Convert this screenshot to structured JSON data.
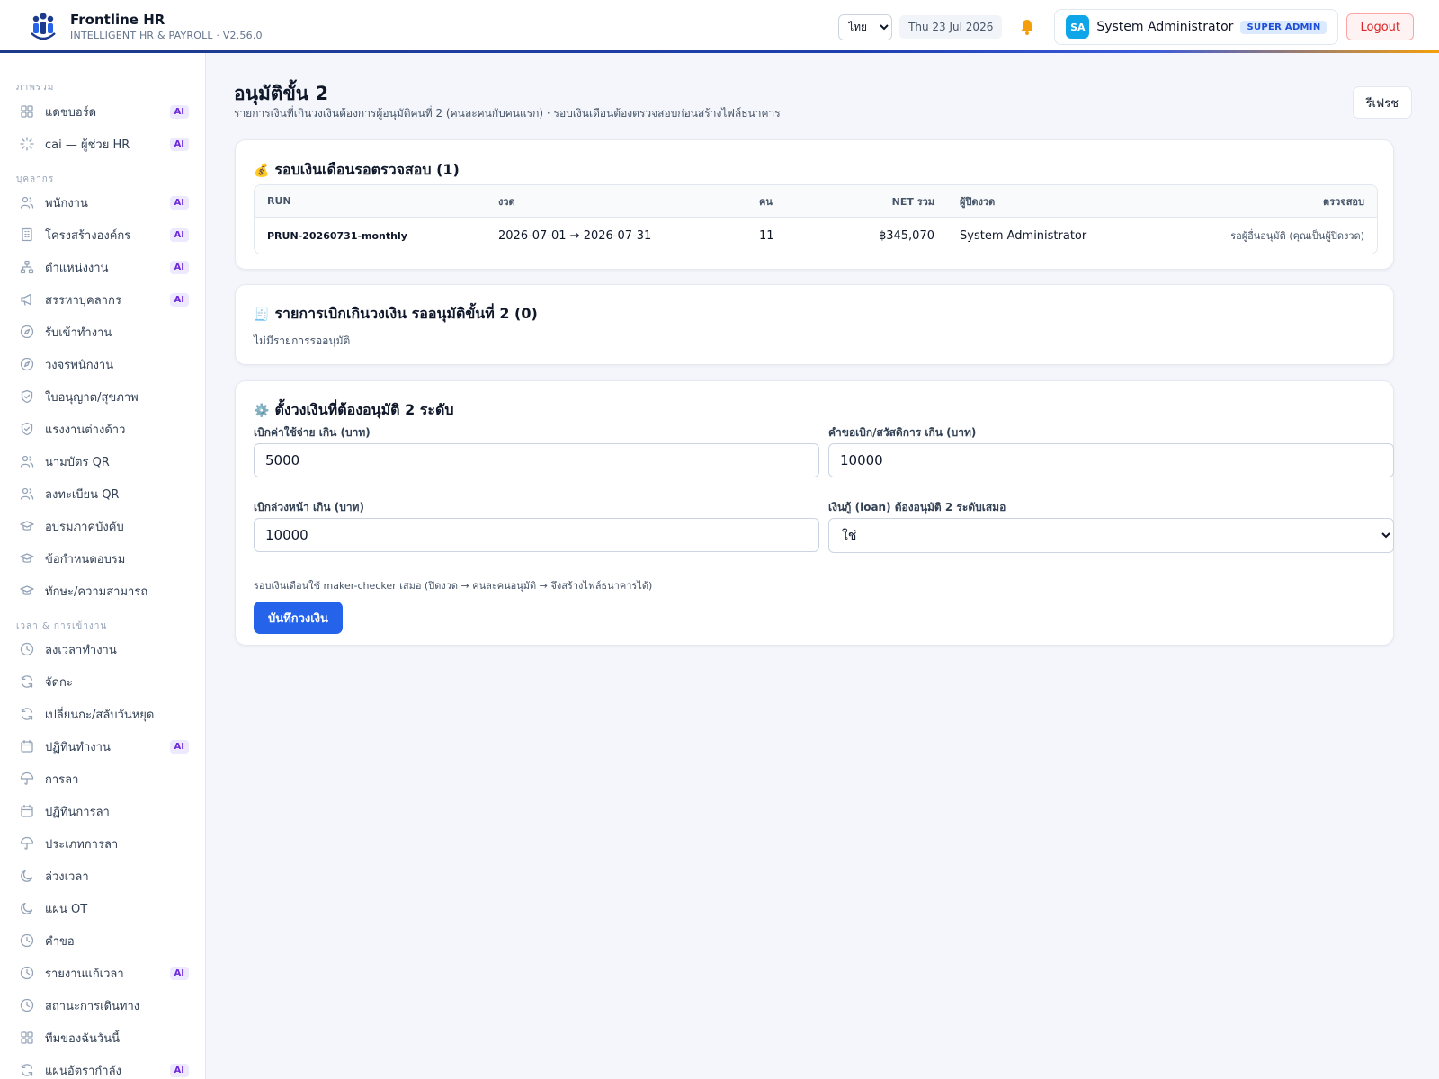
{
  "app": {
    "name": "Frontline HR",
    "subtitle": "INTELLIGENT HR & PAYROLL · V2.56.0"
  },
  "header": {
    "language": "ไทย",
    "date": "Thu 23 Jul 2026",
    "user_initials": "SA",
    "user_name": "System Administrator",
    "role": "SUPER ADMIN",
    "logout_label": "Logout"
  },
  "sidebar": {
    "sections": [
      {
        "title": "ภาพรวม",
        "items": [
          {
            "label": "แดชบอร์ด",
            "icon": "grid-icon",
            "ai": "AI"
          },
          {
            "label": "cai — ผู้ช่วย HR",
            "icon": "sparkle-icon",
            "ai": "AI"
          }
        ]
      },
      {
        "title": "บุคลากร",
        "items": [
          {
            "label": "พนักงาน",
            "icon": "users-icon",
            "ai": "AI"
          },
          {
            "label": "โครงสร้างองค์กร",
            "icon": "building-icon",
            "ai": "AI"
          },
          {
            "label": "ตำแหน่งงาน",
            "icon": "org-chart-icon",
            "ai": "AI"
          },
          {
            "label": "สรรหาบุคลากร",
            "icon": "megaphone-icon",
            "ai": "AI"
          },
          {
            "label": "รับเข้าทำงาน",
            "icon": "compass-icon",
            "ai": ""
          },
          {
            "label": "วงจรพนักงาน",
            "icon": "compass-icon",
            "ai": ""
          },
          {
            "label": "ใบอนุญาต/สุขภาพ",
            "icon": "shield-check-icon",
            "ai": ""
          },
          {
            "label": "แรงงานต่างด้าว",
            "icon": "shield-check-icon",
            "ai": ""
          },
          {
            "label": "นามบัตร QR",
            "icon": "users-icon",
            "ai": ""
          },
          {
            "label": "ลงทะเบียน QR",
            "icon": "users-icon",
            "ai": ""
          },
          {
            "label": "อบรมภาคบังคับ",
            "icon": "graduation-cap-icon",
            "ai": ""
          },
          {
            "label": "ข้อกำหนดอบรม",
            "icon": "graduation-cap-icon",
            "ai": ""
          },
          {
            "label": "ทักษะ/ความสามารถ",
            "icon": "graduation-cap-icon",
            "ai": ""
          }
        ]
      },
      {
        "title": "เวลา & การเข้างาน",
        "items": [
          {
            "label": "ลงเวลาทำงาน",
            "icon": "clock-icon",
            "ai": ""
          },
          {
            "label": "จัดกะ",
            "icon": "refresh-icon",
            "ai": ""
          },
          {
            "label": "เปลี่ยนกะ/สลับวันหยุด",
            "icon": "refresh-icon",
            "ai": ""
          },
          {
            "label": "ปฏิทินทำงาน",
            "icon": "calendar-icon",
            "ai": "AI"
          },
          {
            "label": "การลา",
            "icon": "umbrella-icon",
            "ai": ""
          },
          {
            "label": "ปฏิทินการลา",
            "icon": "calendar-icon",
            "ai": ""
          },
          {
            "label": "ประเภทการลา",
            "icon": "umbrella-icon",
            "ai": ""
          },
          {
            "label": "ล่วงเวลา",
            "icon": "moon-icon",
            "ai": ""
          },
          {
            "label": "แผน OT",
            "icon": "moon-icon",
            "ai": ""
          },
          {
            "label": "คำขอ",
            "icon": "clock-icon",
            "ai": ""
          },
          {
            "label": "รายงานแก้เวลา",
            "icon": "clock-icon",
            "ai": "AI"
          },
          {
            "label": "สถานะการเดินทาง",
            "icon": "clock-icon",
            "ai": ""
          },
          {
            "label": "ทีมของฉันวันนี้",
            "icon": "grid-icon",
            "ai": ""
          },
          {
            "label": "แผนอัตรากำลัง",
            "icon": "refresh-icon",
            "ai": "AI"
          }
        ]
      }
    ]
  },
  "page": {
    "title": "อนุมัติขั้น 2",
    "subtitle": "รายการเงินที่เกินวงเงินต้องการผู้อนุมัติคนที่ 2 (คนละคนกับคนแรก) · รอบเงินเดือนต้องตรวจสอบก่อนสร้างไฟล์ธนาคาร",
    "refresh_label": "รีเฟรช"
  },
  "payroll_card": {
    "emoji": "💰",
    "title": "รอบเงินเดือนรอตรวจสอบ (1)",
    "columns": [
      "RUN",
      "งวด",
      "คน",
      "NET รวม",
      "ผู้ปิดงวด",
      "ตรวจสอบ"
    ],
    "rows": [
      {
        "run": "PRUN-20260731-monthly",
        "period": "2026-07-01 → 2026-07-31",
        "count": "11",
        "net": "฿345,070",
        "closer": "System Administrator",
        "status": "รอผู้อื่นอนุมัติ (คุณเป็นผู้ปิดงวด)"
      }
    ]
  },
  "claims_card": {
    "emoji": "🧾",
    "title": "รายการเบิกเกินวงเงิน รออนุมัติขั้นที่ 2 (0)",
    "empty": "ไม่มีรายการรออนุมัติ"
  },
  "settings_card": {
    "emoji": "⚙️",
    "title": "ตั้งวงเงินที่ต้องอนุมัติ 2 ระดับ",
    "expense_label": "เบิกค่าใช้จ่าย เกิน (บาท)",
    "expense_value": "5000",
    "benefit_label": "คำขอเบิก/สวัสดิการ เกิน (บาท)",
    "benefit_value": "10000",
    "advance_label": "เบิกล่วงหน้า เกิน (บาท)",
    "advance_value": "10000",
    "loan_label": "เงินกู้ (loan) ต้องอนุมัติ 2 ระดับเสมอ",
    "loan_value": "ใช่",
    "note": "รอบเงินเดือนใช้ maker-checker เสมอ (ปิดงวด → คนละคนอนุมัติ → จึงสร้างไฟล์ธนาคารได้)",
    "save_label": "บันทึกวงเงิน"
  }
}
